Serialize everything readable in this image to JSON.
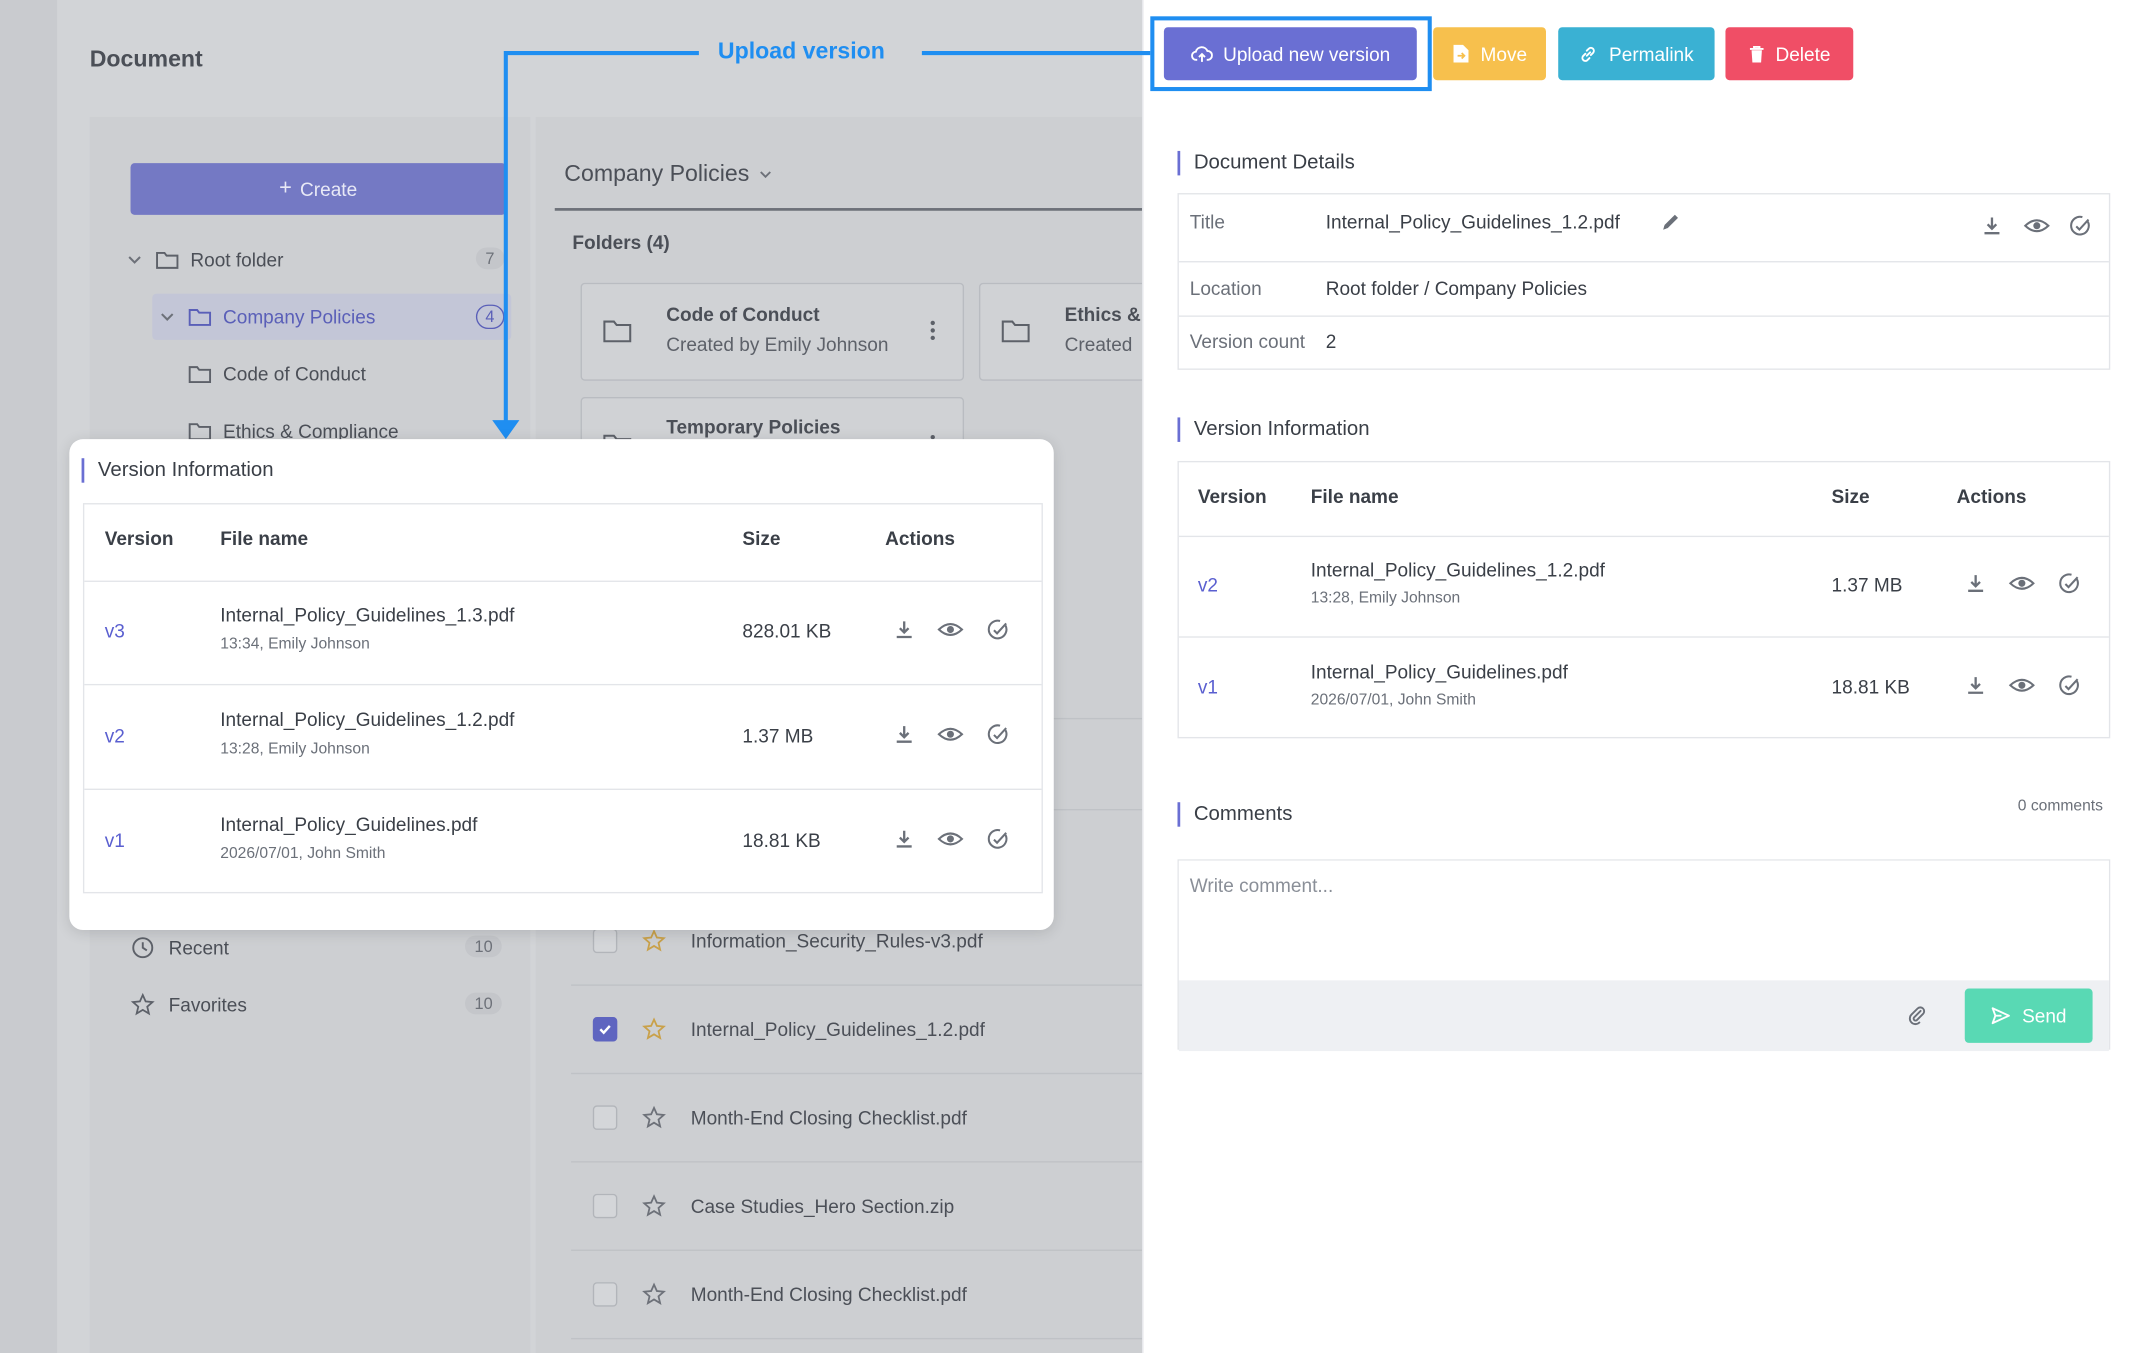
{
  "background": {
    "page_title": "Document",
    "create_label": "Create",
    "tree": [
      {
        "label": "Root folder",
        "count": "7"
      },
      {
        "label": "Company Policies",
        "count": "4"
      },
      {
        "label": "Code of Conduct"
      },
      {
        "label": "Ethics & Compliance"
      }
    ],
    "nav": [
      {
        "label": "Recent",
        "count": "10"
      },
      {
        "label": "Favorites",
        "count": "10"
      }
    ],
    "section_title": "Company Policies",
    "folders_title": "Folders (4)",
    "folders": [
      {
        "name": "Code of Conduct",
        "sub": "Created by Emily Johnson"
      },
      {
        "name": "Ethics &",
        "sub": "Created"
      },
      {
        "name": "Temporary Policies",
        "sub": ""
      }
    ],
    "files": [
      {
        "name": "Information_Security_Rules-v3.pdf",
        "checked": false
      },
      {
        "name": "Internal_Policy_Guidelines_1.2.pdf",
        "checked": true
      },
      {
        "name": "Month-End Closing Checklist.pdf",
        "checked": false
      },
      {
        "name": "Case Studies_Hero Section.zip",
        "checked": false
      },
      {
        "name": "Month-End Closing Checklist.pdf",
        "checked": false
      }
    ]
  },
  "toolbar": {
    "upload_label": "Upload new version",
    "move_label": "Move",
    "permalink_label": "Permalink",
    "delete_label": "Delete"
  },
  "callout": {
    "label": "Upload version"
  },
  "details": {
    "heading": "Document Details",
    "title_label": "Title",
    "title_value": "Internal_Policy_Guidelines_1.2.pdf",
    "location_label": "Location",
    "location_value": "Root folder / Company Policies",
    "version_count_label": "Version count",
    "version_count_value": "2"
  },
  "version_info": {
    "heading": "Version Information",
    "columns": {
      "version": "Version",
      "file": "File name",
      "size": "Size",
      "actions": "Actions"
    },
    "rows": [
      {
        "version": "v2",
        "file": "Internal_Policy_Guidelines_1.2.pdf",
        "meta": "13:28, Emily Johnson",
        "size": "1.37 MB"
      },
      {
        "version": "v1",
        "file": "Internal_Policy_Guidelines.pdf",
        "meta": "2026/07/01, John Smith",
        "size": "18.81 KB"
      }
    ]
  },
  "popup_version_info": {
    "heading": "Version Information",
    "columns": {
      "version": "Version",
      "file": "File name",
      "size": "Size",
      "actions": "Actions"
    },
    "rows": [
      {
        "version": "v3",
        "file": "Internal_Policy_Guidelines_1.3.pdf",
        "meta": "13:34, Emily Johnson",
        "size": "828.01 KB"
      },
      {
        "version": "v2",
        "file": "Internal_Policy_Guidelines_1.2.pdf",
        "meta": "13:28, Emily Johnson",
        "size": "1.37 MB"
      },
      {
        "version": "v1",
        "file": "Internal_Policy_Guidelines.pdf",
        "meta": "2026/07/01, John Smith",
        "size": "18.81 KB"
      }
    ]
  },
  "comments": {
    "heading": "Comments",
    "count": "0 comments",
    "placeholder": "Write comment...",
    "send_label": "Send"
  },
  "colors": {
    "accent": "#6a6fd3",
    "move": "#f7c04d",
    "permalink": "#3ab1d3",
    "delete": "#f04e66",
    "send": "#59d9b4",
    "callout": "#1f8ef1"
  }
}
